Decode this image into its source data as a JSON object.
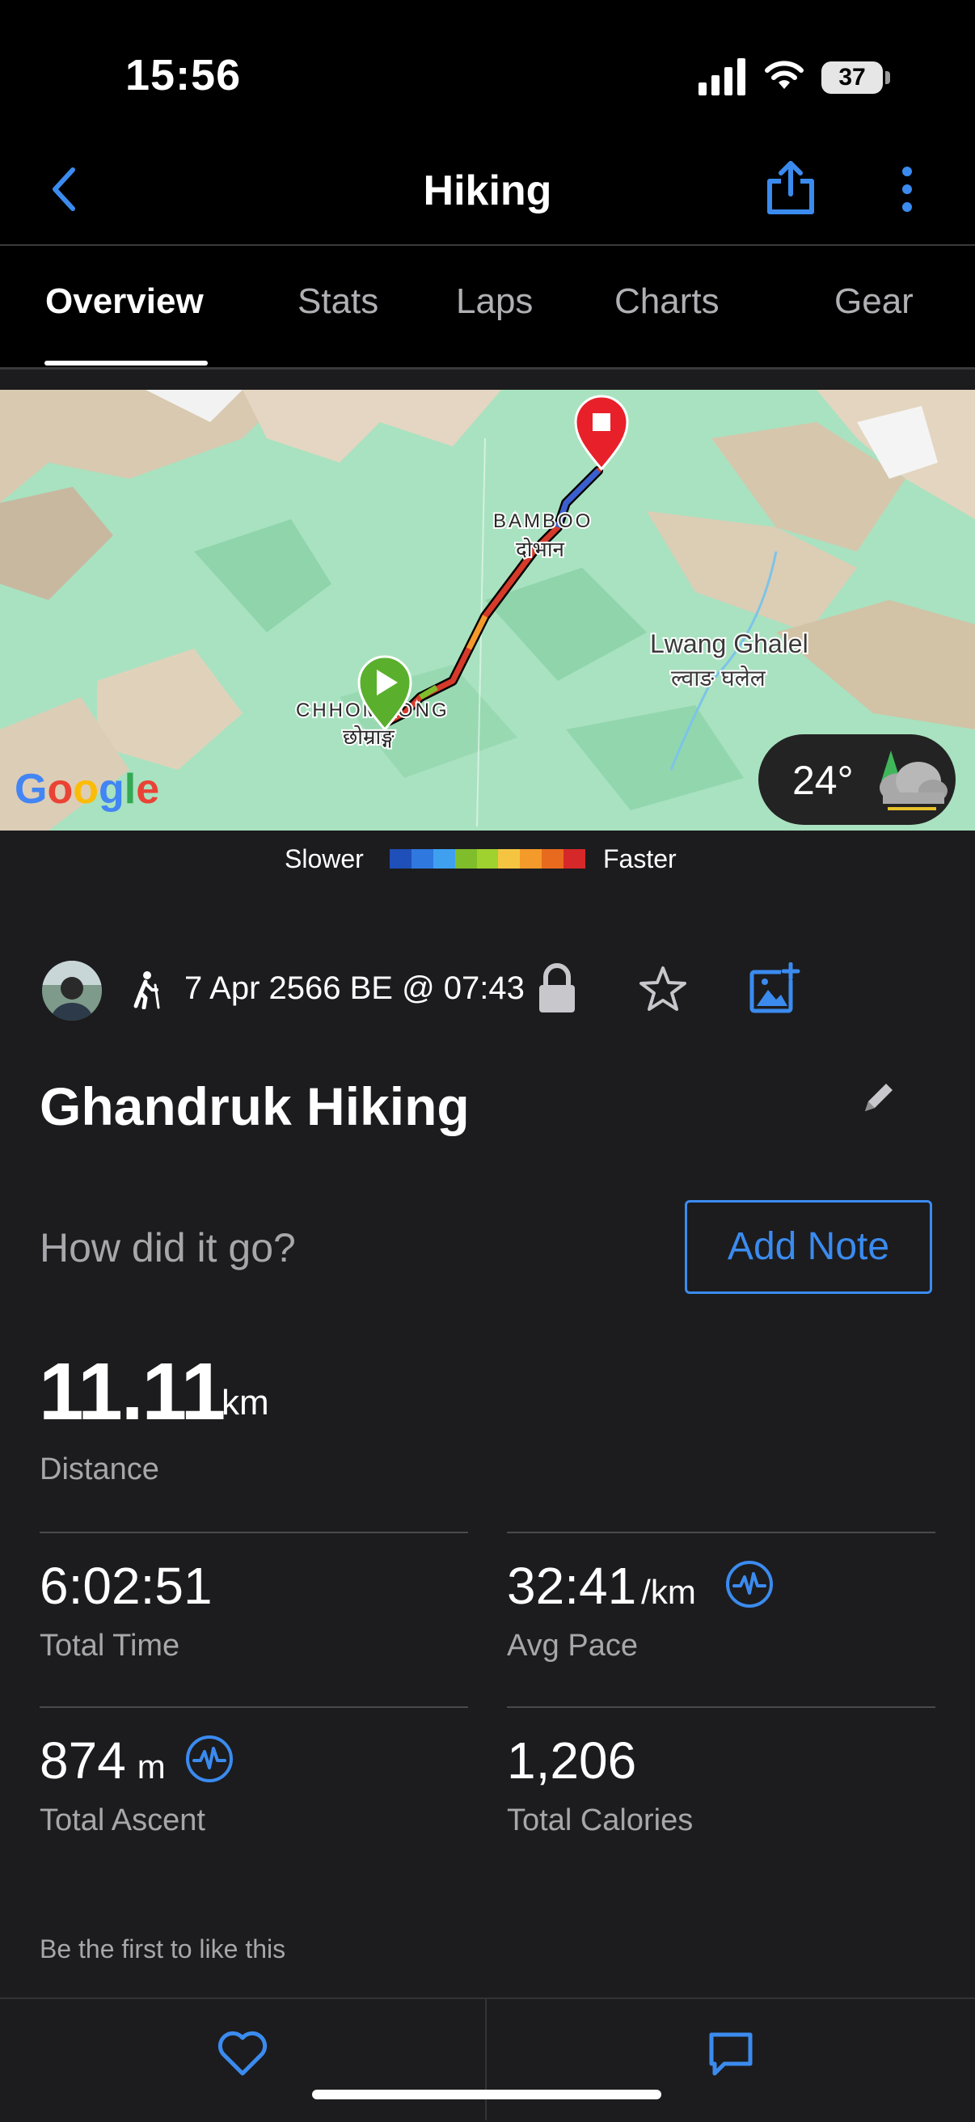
{
  "status_bar": {
    "time": "15:56",
    "battery": "37"
  },
  "nav": {
    "title": "Hiking"
  },
  "tabs": [
    {
      "label": "Overview",
      "active": true
    },
    {
      "label": "Stats",
      "active": false
    },
    {
      "label": "Laps",
      "active": false
    },
    {
      "label": "Charts",
      "active": false
    },
    {
      "label": "Gear",
      "active": false
    }
  ],
  "map": {
    "labels": {
      "bamboo_en": "BAMBOO",
      "bamboo_np": "दोभान",
      "lwang_en": "Lwang Ghalel",
      "lwang_np": "ल्वाङ घलेल",
      "chhomrong_en": "CHHOMRONG",
      "chhomrong_np": "छोम्राङ्ग"
    },
    "weather_temp": "24°",
    "provider": "Google"
  },
  "pace_legend": {
    "slower": "Slower",
    "faster": "Faster",
    "colors": [
      "#1f4fb8",
      "#2f78e0",
      "#3fa0f0",
      "#7fbe2a",
      "#9fd12f",
      "#f5c542",
      "#f39a2a",
      "#e86a1e",
      "#d62828"
    ]
  },
  "activity": {
    "date": "7 Apr 2566 BE @ 07:43",
    "name": "Ghandruk Hiking",
    "prompt": "How did it go?",
    "add_note": "Add Note"
  },
  "stats": {
    "distance": {
      "value": "11.11",
      "unit": "km",
      "label": "Distance"
    },
    "total_time": {
      "value": "6:02:51",
      "label": "Total Time"
    },
    "avg_pace": {
      "value": "32:41",
      "unit": "/km",
      "label": "Avg Pace"
    },
    "total_ascent": {
      "value": "874",
      "unit": "m",
      "label": "Total Ascent"
    },
    "total_calories": {
      "value": "1,206",
      "label": "Total Calories"
    }
  },
  "social": {
    "likes_text": "Be the first to like this"
  },
  "colors": {
    "accent": "#3b8bef",
    "start_marker": "#5ab02d",
    "end_marker": "#e8202a"
  }
}
